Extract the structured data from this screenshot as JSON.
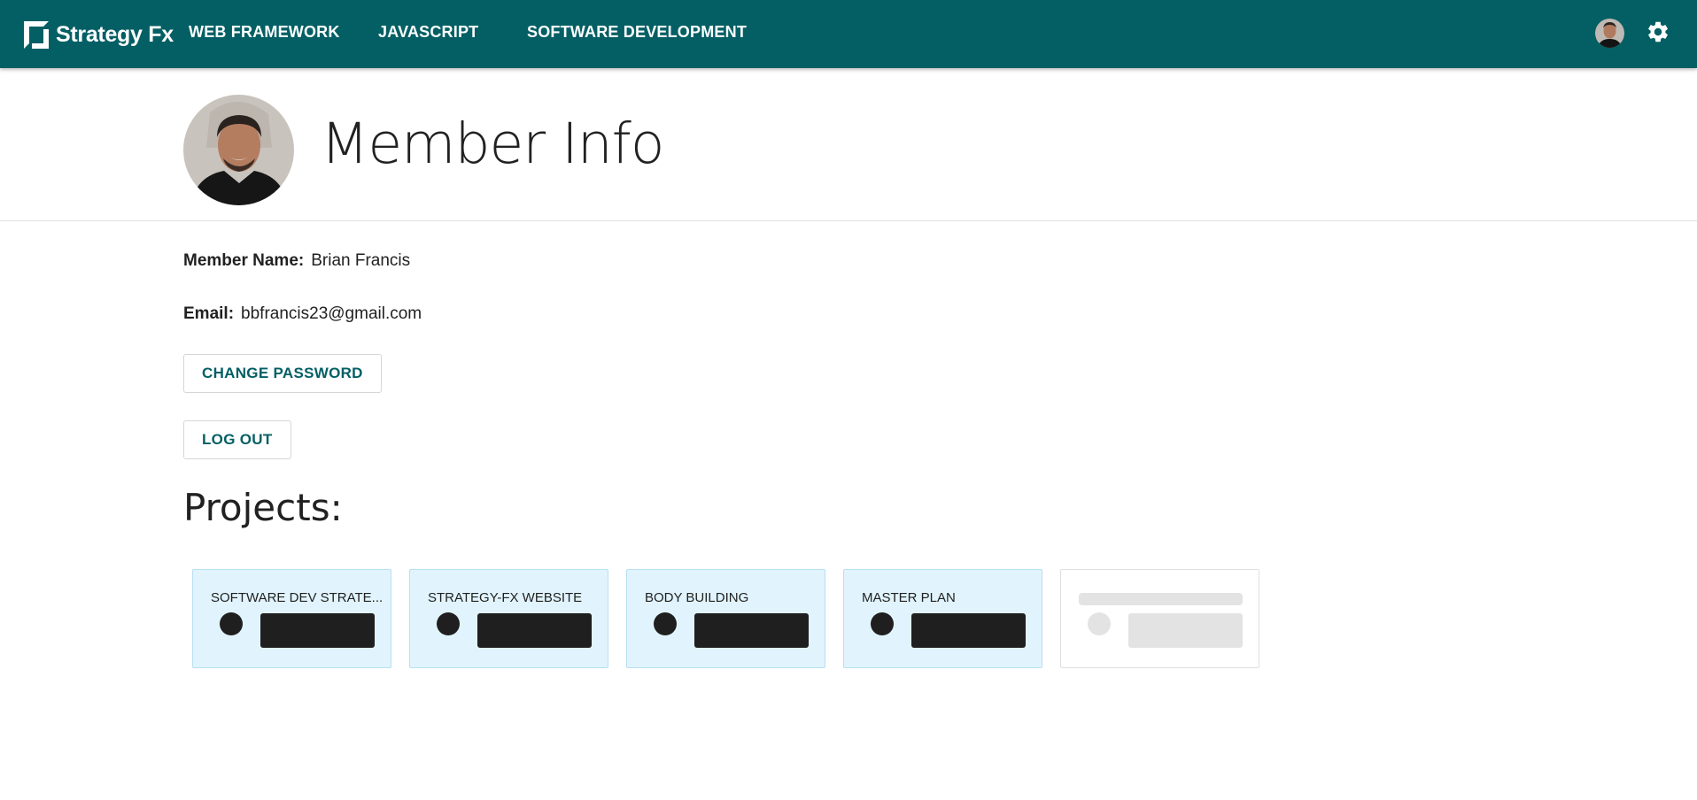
{
  "app": {
    "logo_text": "Strategy Fx",
    "brand_color": "#035f64"
  },
  "nav": {
    "items": [
      {
        "label": "WEB FRAMEWORK"
      },
      {
        "label": "JAVASCRIPT"
      },
      {
        "label": "SOFTWARE DEVELOPMENT"
      }
    ]
  },
  "header": {
    "title": "Member Info"
  },
  "member": {
    "name_label": "Member Name:",
    "name": "Brian Francis",
    "email_label": "Email:",
    "email": "bbfrancis23@gmail.com"
  },
  "actions": {
    "change_password": "CHANGE PASSWORD",
    "log_out": "LOG OUT"
  },
  "projects": {
    "title": "Projects:",
    "items": [
      {
        "name": "SOFTWARE DEV STRATE..."
      },
      {
        "name": "STRATEGY-FX WEBSITE"
      },
      {
        "name": "BODY BUILDING"
      },
      {
        "name": "MASTER PLAN"
      }
    ],
    "card_color": "#e1f4fd"
  }
}
